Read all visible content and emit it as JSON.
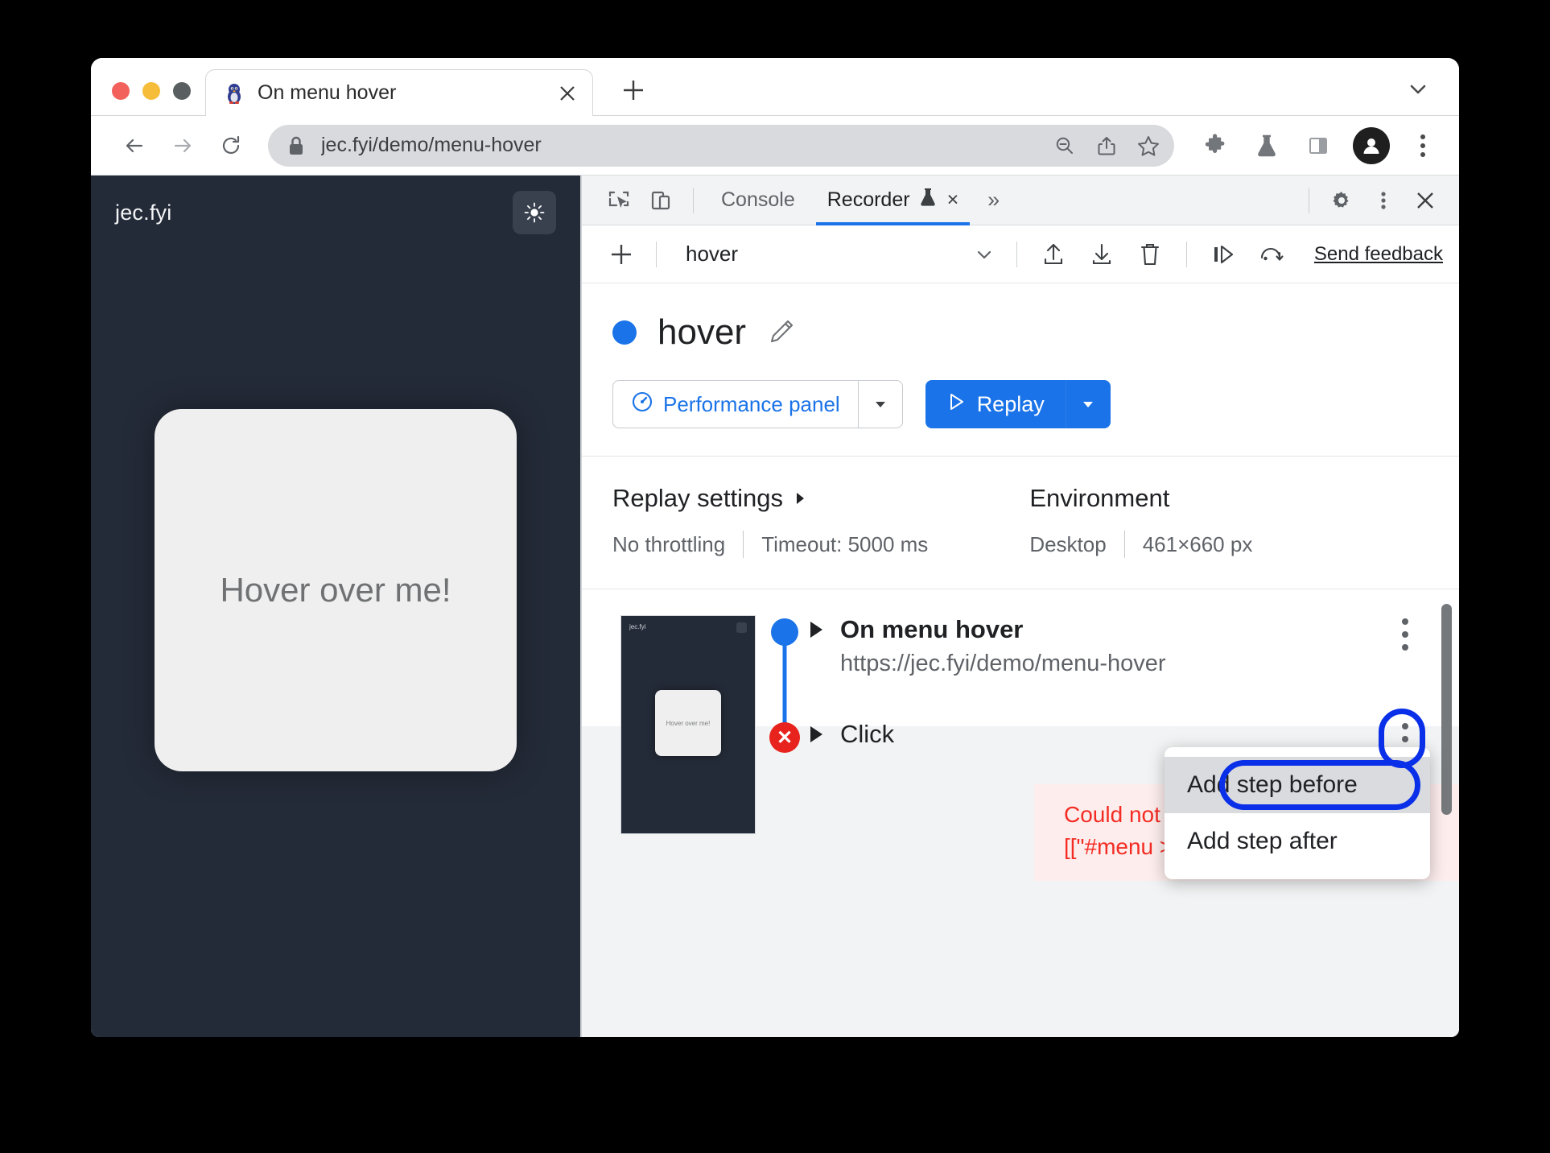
{
  "browser": {
    "tab": {
      "title": "On menu hover",
      "favicon": "penguin-favicon",
      "close": "×"
    },
    "newtab_label": "+",
    "tabstrip_chevron": "chevron-down-icon",
    "omnibox": {
      "url": "jec.fyi/demo/menu-hover",
      "lock": "lock-icon"
    },
    "nav": {
      "back": "←",
      "forward": "→",
      "reload": "⟳"
    },
    "omni_actions": [
      "zoom-out-icon",
      "share-icon",
      "bookmark-star-icon"
    ],
    "toolbar_icons": [
      "extensions-puzzle-icon",
      "labs-flask-icon",
      "side-panel-icon"
    ],
    "avatar": "profile-avatar",
    "menu": "browser-kebab-menu"
  },
  "page": {
    "brand": "jec.fyi",
    "theme_toggle": "sun-icon",
    "card_text": "Hover over me!"
  },
  "devtools": {
    "tabs": [
      {
        "label": "Console",
        "active": false
      },
      {
        "label": "Recorder",
        "active": true
      }
    ],
    "recorder_flask": "experiment-flask-icon",
    "recorder_close": "×",
    "more_tabs": "»",
    "inspect_icon": "inspect-element-icon",
    "device_icon": "device-toolbar-icon",
    "settings_icon": "gear-icon",
    "kebab_icon": "dots-vertical-icon",
    "close_icon": "close-icon"
  },
  "recorder": {
    "toolbar": {
      "add": "+",
      "selected_recording": "hover",
      "chevron": "chevron-down-icon",
      "import": "import-icon",
      "export": "export-icon",
      "delete": "trash-icon",
      "step_over": "step-over-icon",
      "replay_history": "replay-history-icon",
      "feedback": "Send feedback"
    },
    "title": "hover",
    "edit_icon": "pencil-icon",
    "performance_button": "Performance panel",
    "performance_icon": "speedometer-icon",
    "replay_button": "Replay",
    "replay_icon": "play-triangle-icon",
    "replay_settings": {
      "heading": "Replay settings",
      "caret": "▶",
      "throttling": "No throttling",
      "timeout": "Timeout: 5000 ms"
    },
    "environment": {
      "heading": "Environment",
      "device": "Desktop",
      "viewport": "461×660 px"
    },
    "steps": [
      {
        "label": "On menu hover",
        "url": "https://jec.fyi/demo/menu-hover",
        "status": "ok",
        "kebab": "step-options-icon"
      },
      {
        "label": "Click",
        "status": "error",
        "kebab": "step-options-icon",
        "error_lines": [
          "Could not find ele",
          "[[\"#menu > li:nth-"
        ]
      }
    ],
    "thumbnail": {
      "brand": "jec.fyi",
      "card_text": "Hover over me!"
    },
    "context_menu": {
      "items": [
        {
          "label": "Add step before",
          "highlighted": true
        },
        {
          "label": "Add step after",
          "highlighted": false
        }
      ]
    }
  },
  "colors": {
    "accent": "#1a73e8",
    "error": "#e8231d",
    "error_text": "#f42c24",
    "annotation": "#0a2fe8",
    "page_bg": "#242b38",
    "devtools_bg": "#f1f3f4"
  }
}
